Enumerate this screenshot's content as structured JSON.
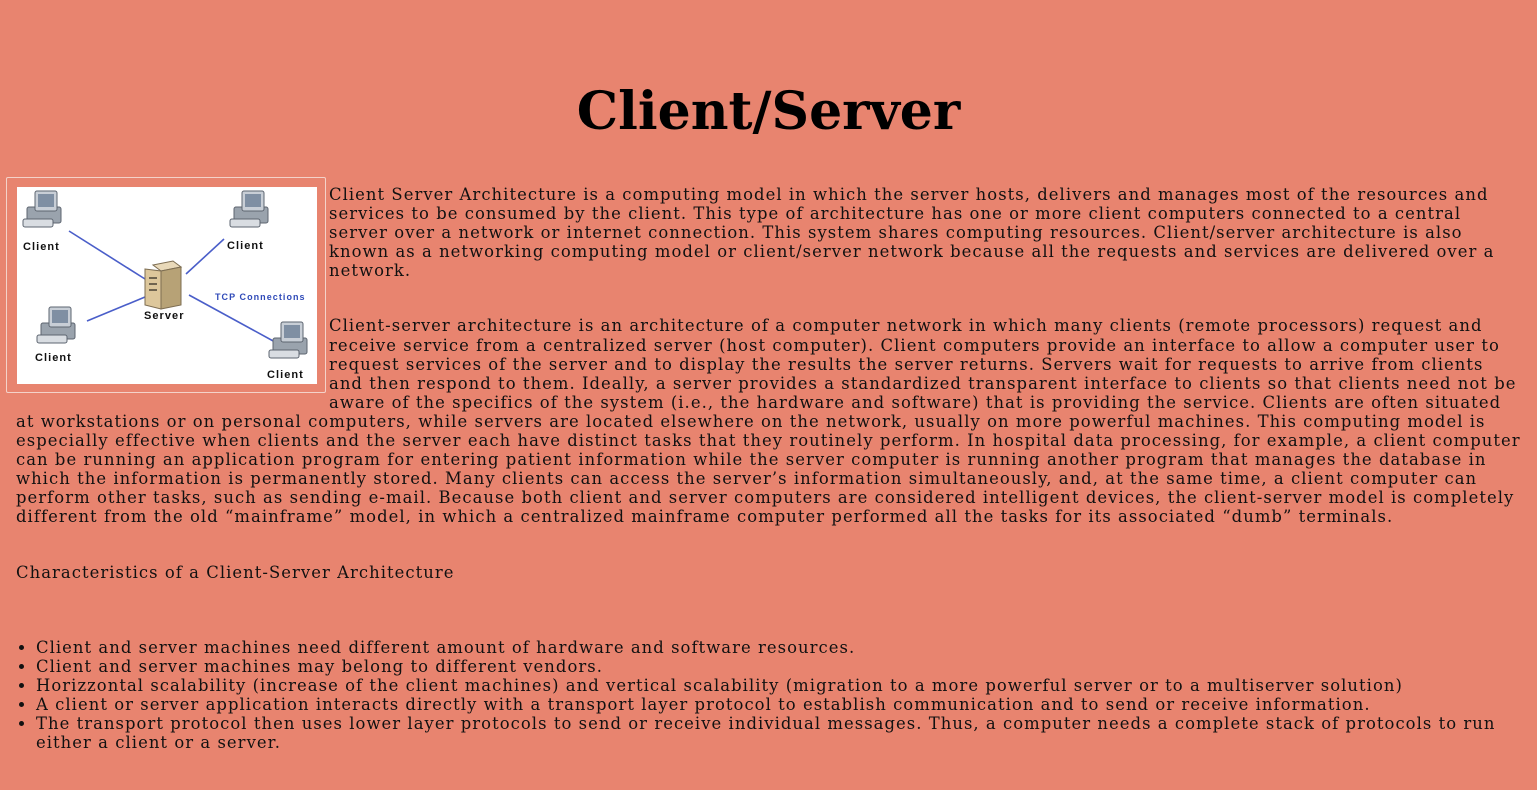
{
  "title": "Client/Server",
  "diagram": {
    "labels": {
      "client_top_left": "Client",
      "client_top_right": "Client",
      "client_bottom_left": "Client",
      "client_bottom_right": "Client",
      "server": "Server",
      "connections": "TCP Connections"
    },
    "colors": {
      "line": "#4a5ec9",
      "connections_text": "#2f4ab8"
    }
  },
  "paragraphs": [
    "Client Server Architecture is a computing model in which the server hosts, delivers and manages most of the resources and services to be consumed by the client. This type of architecture has one or more client computers connected to a central server over a network or internet connection. This system shares computing resources. Client/server architecture is also known as a networking computing model or client/server network because all the requests and services are delivered over a network.",
    "Client-server architecture is an architecture of a computer network in which many clients (remote processors) request and receive service from a centralized server (host computer). Client computers provide an interface to allow a computer user to request services of the server and to display the results the server returns. Servers wait for requests to arrive from clients and then respond to them. Ideally, a server provides a standardized transparent interface to clients so that clients need not be aware of the specifics of the system (i.e., the hardware and software) that is providing the service. Clients are often situated at workstations or on personal computers, while servers are located elsewhere on the network, usually on more powerful machines. This computing model is especially effective when clients and the server each have distinct tasks that they routinely perform. In hospital data processing, for example, a client computer can be running an application program for entering patient information while the server computer is running another program that manages the database in which the information is permanently stored. Many clients can access the server’s information simultaneously, and, at the same time, a client computer can perform other tasks, such as sending e-mail. Because both client and server computers are considered intelligent devices, the client-server model is completely different from the old “mainframe” model, in which a centralized mainframe computer performed all the tasks for its associated “dumb” terminals."
  ],
  "characteristics_heading": "Characteristics of a Client-Server Architecture",
  "characteristics": [
    "Client and server machines need different amount of hardware and software resources.",
    "Client and server machines may belong to different vendors.",
    "Horizzontal scalability (increase of the client machines) and vertical scalability (migration to a more powerful server or to a multiserver solution)",
    "A client or server application interacts directly with a transport layer protocol to establish communication and to send or receive information.",
    "The transport protocol then uses lower layer protocols to send or receive individual messages. Thus, a computer needs a complete stack of protocols to run either a client or a server."
  ]
}
